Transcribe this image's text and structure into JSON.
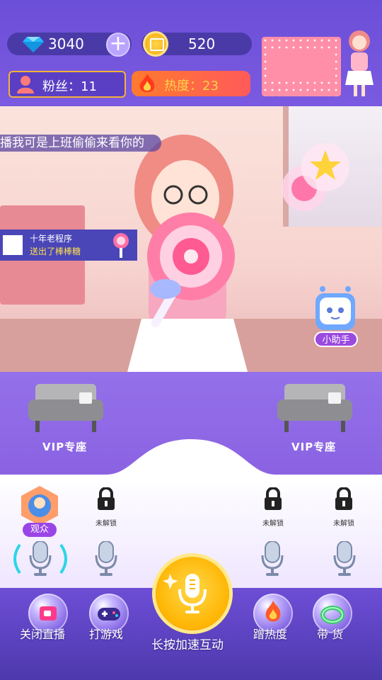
{
  "top": {
    "diamonds": "3040",
    "coins": "520",
    "fans": "粉丝：11",
    "heat": "热度：23"
  },
  "scene": {
    "marquee": "播我可是上班偷偷来看你的",
    "gift": {
      "sender": "十年老程序",
      "message": "送出了棒棒糖"
    },
    "helper_label": "小助手"
  },
  "seats": {
    "vip_left": "VIP专座",
    "vip_right": "VIP专座",
    "viewer_label": "观众",
    "locked_label": "未解锁"
  },
  "bottom": {
    "close_live": "关闭直播",
    "play_game": "打游戏",
    "hold_accelerate": "长按加速互动",
    "give_heat": "蹭热度",
    "sell_goods": "带 货"
  },
  "colors": {
    "accent": "#6c4fd8",
    "gold": "#ffb400",
    "heat": "#ff6a3a"
  },
  "icons": [
    "diamond-icon",
    "plus-icon",
    "coin-icon",
    "person-icon",
    "flame-icon",
    "lock-icon",
    "mic-icon",
    "camera-icon",
    "gamepad-icon",
    "ring-icon",
    "lollipop-icon"
  ]
}
